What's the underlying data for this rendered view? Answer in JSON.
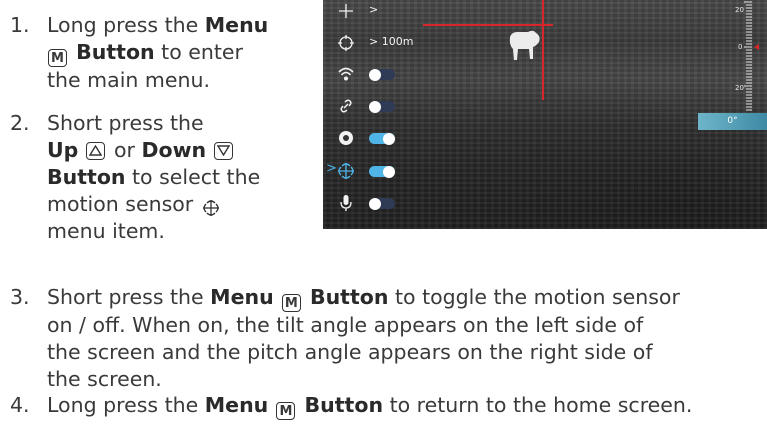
{
  "steps": [
    {
      "num": "1.",
      "lines": [
        [
          "Long press the ",
          {
            "b": "Menu"
          }
        ],
        [
          {
            "key": "M"
          },
          {
            "b": " Button"
          },
          " to enter"
        ],
        [
          "the main menu."
        ]
      ]
    },
    {
      "num": "2.",
      "lines": [
        [
          "Short press the"
        ],
        [
          {
            "b": "Up "
          },
          {
            "key": "up"
          },
          " or ",
          {
            "b": "Down "
          },
          {
            "key": "down"
          }
        ],
        [
          {
            "b": "Button"
          },
          " to select the"
        ],
        [
          "motion sensor ",
          {
            "key": "motion"
          }
        ],
        [
          "menu item."
        ]
      ]
    },
    {
      "num": "3.",
      "lines": [
        [
          "Short press the ",
          {
            "b": "Menu "
          },
          {
            "key": "M"
          },
          {
            "b": " Button"
          },
          " to toggle the motion sensor"
        ],
        [
          "on / off. When on, the tilt angle appears on the left side of"
        ],
        [
          "the screen and the pitch angle appears on the right side of"
        ],
        [
          "the screen."
        ]
      ]
    },
    {
      "num": "4.",
      "lines": [
        [
          "Long press the ",
          {
            "b": "Menu "
          },
          {
            "key": "M"
          },
          {
            "b": " Button"
          },
          " to return to the home screen."
        ]
      ]
    }
  ],
  "device": {
    "menu": [
      {
        "icon": "crosshair-icon",
        "value": ">"
      },
      {
        "icon": "zeroing-icon",
        "value": "> 100m"
      },
      {
        "icon": "wifi-icon",
        "toggle": "off"
      },
      {
        "icon": "link-icon",
        "toggle": "off"
      },
      {
        "icon": "shutter-icon",
        "toggle": "on"
      },
      {
        "icon": "motion-sensor-icon",
        "toggle": "on",
        "selected": true
      },
      {
        "icon": "microphone-icon",
        "toggle": "off"
      }
    ],
    "scale_labels": [
      "20",
      "0",
      "20"
    ],
    "pitch_value": "0°",
    "colors": {
      "crosshair": "#d8262a",
      "accent": "#4fb4e6"
    }
  }
}
